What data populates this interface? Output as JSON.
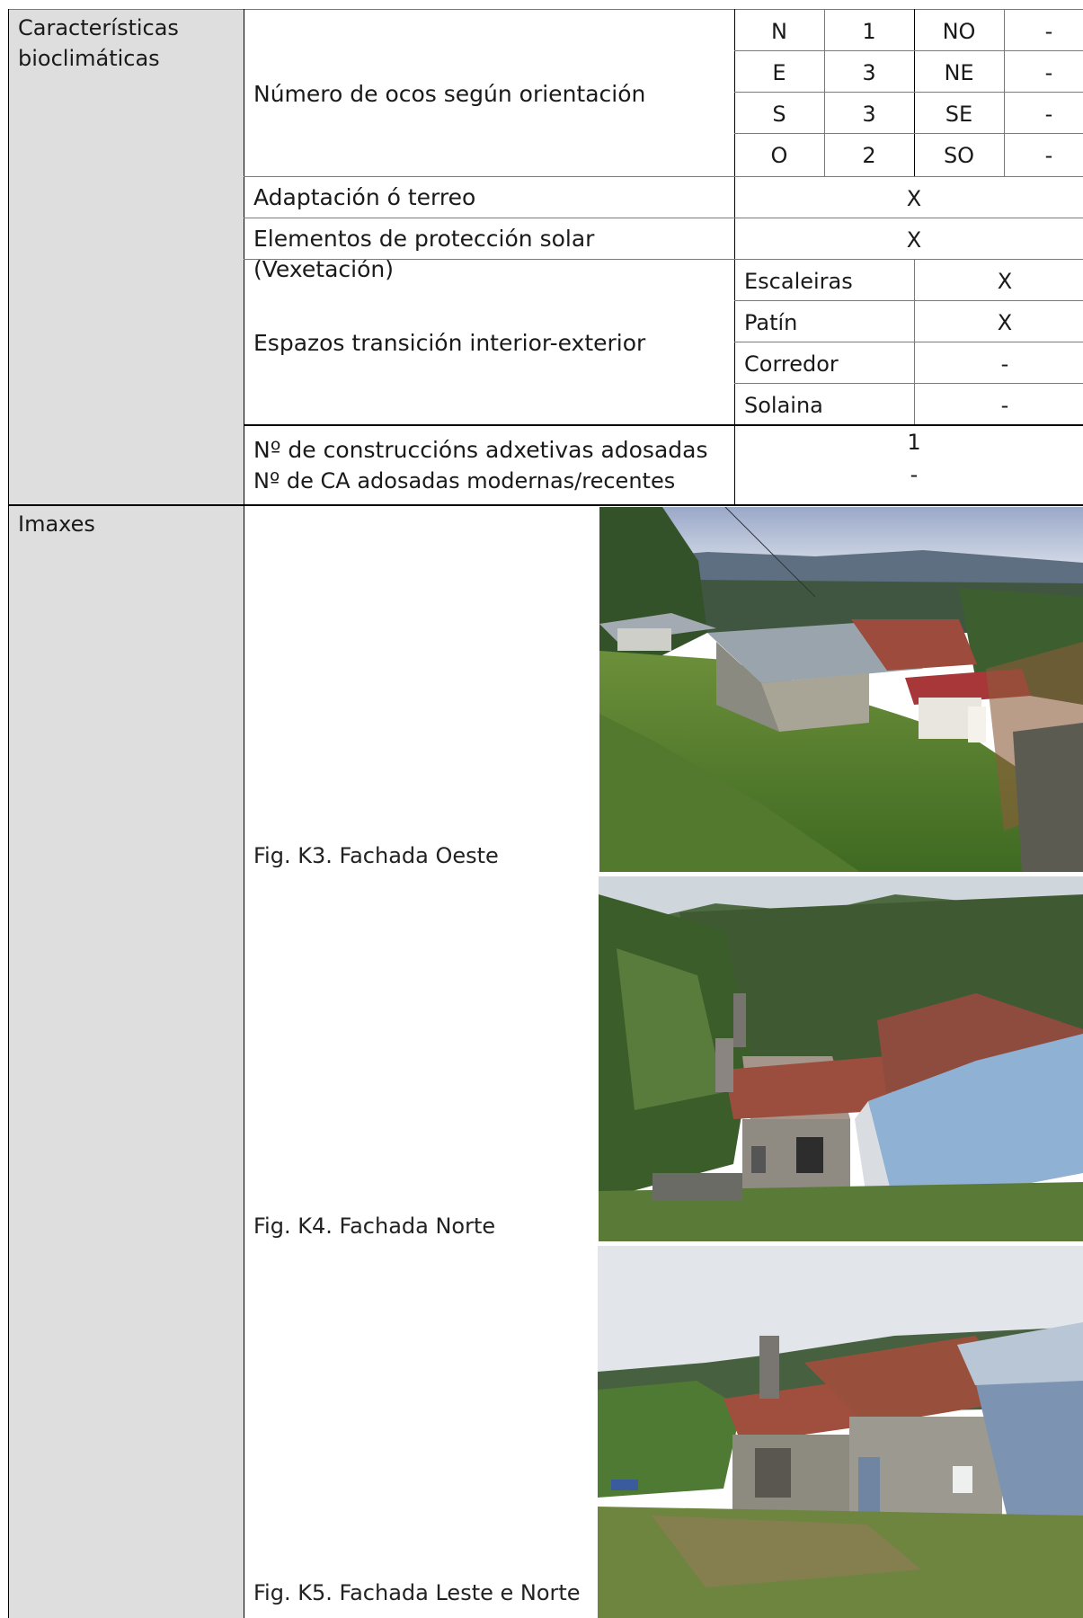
{
  "section_bioclimatic": {
    "label": "Características bioclimáticas",
    "openings": {
      "label": "Número de ocos según orientación",
      "rows": [
        [
          "N",
          "1",
          "NO",
          "-"
        ],
        [
          "E",
          "3",
          "NE",
          "-"
        ],
        [
          "S",
          "3",
          "SE",
          "-"
        ],
        [
          "O",
          "2",
          "SO",
          "-"
        ]
      ]
    },
    "terrain": {
      "label": "Adaptación ó terreo",
      "value": "X"
    },
    "solar": {
      "label": "Elementos de protección solar (Vexetación)",
      "value": "X"
    },
    "transition": {
      "label": "Espazos transición interior-exterior",
      "items": [
        {
          "name": "Escaleiras",
          "value": "X"
        },
        {
          "name": "Patín",
          "value": "X"
        },
        {
          "name": "Corredor",
          "value": "-"
        },
        {
          "name": "Solaina",
          "value": "-"
        }
      ]
    },
    "attached": {
      "label": "Nº de construccións adxetivas adosadas",
      "sublabel": "Nº de CA adosadas modernas/recentes",
      "value": "1",
      "subvalue": "-"
    }
  },
  "section_images": {
    "label": "Imaxes",
    "figures": [
      {
        "caption": "Fig. K3. Fachada Oeste"
      },
      {
        "caption": "Fig. K4. Fachada Norte"
      },
      {
        "caption": "Fig. K5. Fachada Leste e Norte"
      }
    ]
  },
  "colors": {
    "label_column_bg": "#dedede",
    "border": "#000000",
    "inner_border": "#7a7a7a"
  }
}
